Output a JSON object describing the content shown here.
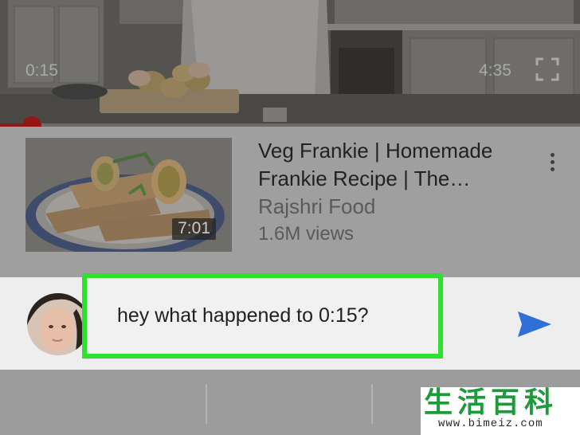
{
  "player": {
    "current_time": "0:15",
    "total_time": "4:35",
    "progress": 0.0545
  },
  "up_next": {
    "title": "Veg Frankie | Homemade Frankie Recipe | The…",
    "channel": "Rajshri Food",
    "views": "1.6M views",
    "duration": "7:01"
  },
  "comment": {
    "value": "hey what happened to 0:15?"
  },
  "watermark": {
    "chars": "生活百科",
    "url": "www.bimeiz.com"
  },
  "colors": {
    "progress": "#8d1a1a",
    "highlight_border": "#2ee12e",
    "send_icon": "#2f6fd8"
  }
}
